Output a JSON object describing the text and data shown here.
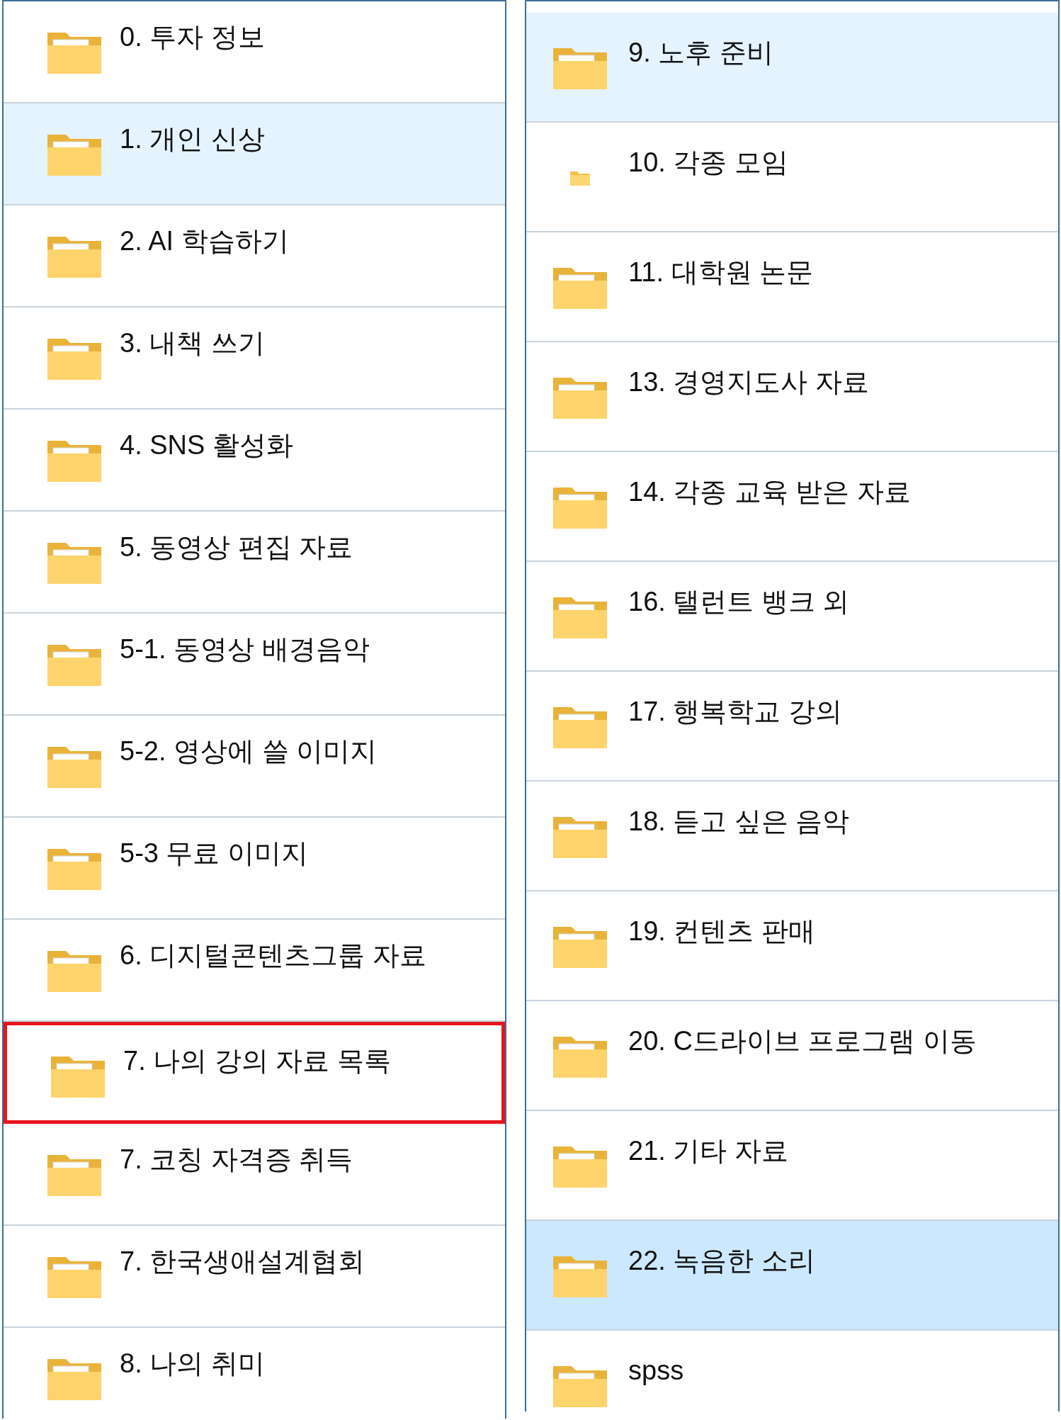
{
  "panels": [
    {
      "items": [
        {
          "label": "0. 투자 정보",
          "selected": false,
          "hovered": false,
          "boxed": false,
          "kind": "folder"
        },
        {
          "label": "1. 개인 신상",
          "selected": false,
          "hovered": true,
          "boxed": false,
          "kind": "folder"
        },
        {
          "label": "2. AI 학습하기",
          "selected": false,
          "hovered": false,
          "boxed": false,
          "kind": "folder"
        },
        {
          "label": "3. 내책 쓰기",
          "selected": false,
          "hovered": false,
          "boxed": false,
          "kind": "folder"
        },
        {
          "label": "4. SNS 활성화",
          "selected": false,
          "hovered": false,
          "boxed": false,
          "kind": "folder"
        },
        {
          "label": "5. 동영상 편집 자료",
          "selected": false,
          "hovered": false,
          "boxed": false,
          "kind": "folder"
        },
        {
          "label": "5-1. 동영상 배경음악",
          "selected": false,
          "hovered": false,
          "boxed": false,
          "kind": "folder"
        },
        {
          "label": "5-2. 영상에 쓸 이미지",
          "selected": false,
          "hovered": false,
          "boxed": false,
          "kind": "folder"
        },
        {
          "label": "5-3 무료 이미지",
          "selected": false,
          "hovered": false,
          "boxed": false,
          "kind": "folder"
        },
        {
          "label": "6. 디지털콘텐츠그룹 자료",
          "selected": false,
          "hovered": false,
          "boxed": false,
          "kind": "folder"
        },
        {
          "label": "7. 나의 강의 자료 목록",
          "selected": false,
          "hovered": false,
          "boxed": true,
          "kind": "folder"
        },
        {
          "label": "7. 코칭 자격증 취득",
          "selected": false,
          "hovered": false,
          "boxed": false,
          "kind": "folder"
        },
        {
          "label": "7. 한국생애설계협회",
          "selected": false,
          "hovered": false,
          "boxed": false,
          "kind": "folder"
        },
        {
          "label": "8. 나의 취미",
          "selected": false,
          "hovered": false,
          "boxed": false,
          "kind": "folder"
        }
      ]
    },
    {
      "items": [
        {
          "label": "9. 노후 준비",
          "selected": false,
          "hovered": true,
          "boxed": false,
          "kind": "folder"
        },
        {
          "label": "10. 각종 모임",
          "selected": false,
          "hovered": false,
          "boxed": false,
          "kind": "minifolder"
        },
        {
          "label": "11. 대학원 논문",
          "selected": false,
          "hovered": false,
          "boxed": false,
          "kind": "folder"
        },
        {
          "label": "13. 경영지도사 자료",
          "selected": false,
          "hovered": false,
          "boxed": false,
          "kind": "folder"
        },
        {
          "label": "14. 각종 교육 받은 자료",
          "selected": false,
          "hovered": false,
          "boxed": false,
          "kind": "folder"
        },
        {
          "label": "16. 탤런트 뱅크 외",
          "selected": false,
          "hovered": false,
          "boxed": false,
          "kind": "folder"
        },
        {
          "label": "17. 행복학교 강의",
          "selected": false,
          "hovered": false,
          "boxed": false,
          "kind": "folder"
        },
        {
          "label": "18. 듣고 싶은 음악",
          "selected": false,
          "hovered": false,
          "boxed": false,
          "kind": "folder"
        },
        {
          "label": "19. 컨텐츠 판매",
          "selected": false,
          "hovered": false,
          "boxed": false,
          "kind": "folder"
        },
        {
          "label": "20. C드라이브 프로그램 이동",
          "selected": false,
          "hovered": false,
          "boxed": false,
          "kind": "folder"
        },
        {
          "label": "21. 기타 자료",
          "selected": false,
          "hovered": false,
          "boxed": false,
          "kind": "folder"
        },
        {
          "label": "22. 녹음한 소리",
          "selected": true,
          "hovered": false,
          "boxed": false,
          "kind": "folder"
        },
        {
          "label": "spss",
          "selected": false,
          "hovered": false,
          "boxed": false,
          "kind": "folder"
        }
      ]
    }
  ]
}
